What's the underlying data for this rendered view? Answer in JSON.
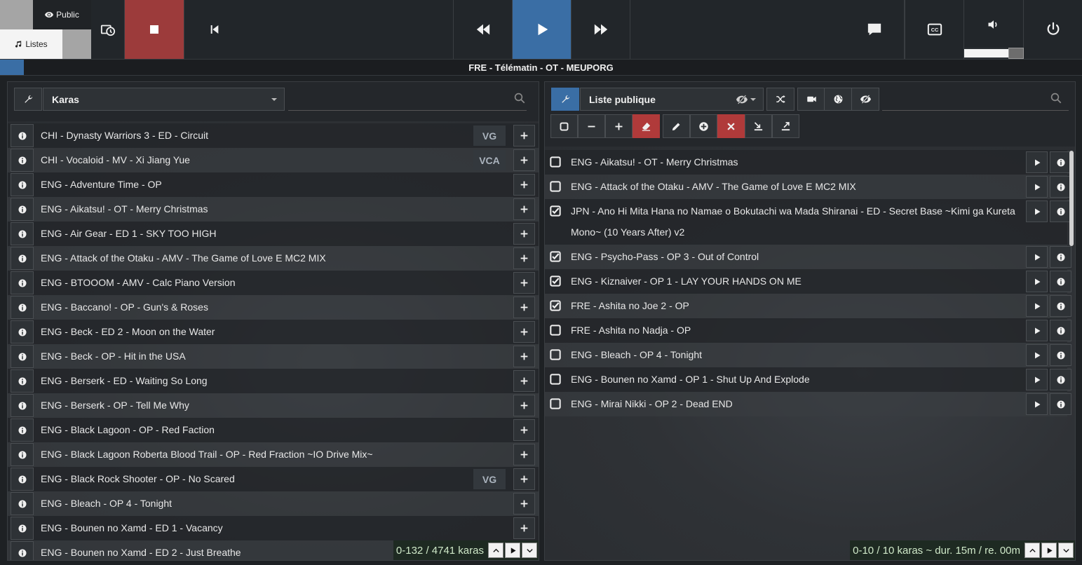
{
  "topbar": {
    "public_label": "Public",
    "listes_label": "Listes",
    "volume_level": 0.74
  },
  "player": {
    "now_playing": "FRE - Télématin - OT - MEUPORG",
    "progress": 0.022
  },
  "left": {
    "playlist_select": "Karas",
    "search_placeholder": "",
    "rows": [
      {
        "label": "CHI - Dynasty Warriors 3 - ED - Circuit",
        "tag": "VG"
      },
      {
        "label": "CHI - Vocaloid - MV - Xi Jiang Yue",
        "tag": "VCA"
      },
      {
        "label": "ENG - Adventure Time - OP",
        "tag": ""
      },
      {
        "label": "ENG - Aikatsu! - OT - Merry Christmas",
        "tag": ""
      },
      {
        "label": "ENG - Air Gear - ED 1 - SKY TOO HIGH",
        "tag": ""
      },
      {
        "label": "ENG - Attack of the Otaku - AMV - The Game of Love E MC2 MIX",
        "tag": ""
      },
      {
        "label": "ENG - BTOOOM - AMV - Calc Piano Version",
        "tag": ""
      },
      {
        "label": "ENG - Baccano! - OP - Gun's & Roses",
        "tag": ""
      },
      {
        "label": "ENG - Beck - ED 2 - Moon on the Water",
        "tag": ""
      },
      {
        "label": "ENG - Beck - OP - Hit in the USA",
        "tag": ""
      },
      {
        "label": "ENG - Berserk - ED - Waiting So Long",
        "tag": ""
      },
      {
        "label": "ENG - Berserk - OP - Tell Me Why",
        "tag": ""
      },
      {
        "label": "ENG - Black Lagoon - OP - Red Faction",
        "tag": ""
      },
      {
        "label": "ENG - Black Lagoon Roberta Blood Trail - OP - Red Fraction ~IO Drive Mix~",
        "tag": ""
      },
      {
        "label": "ENG - Black Rock Shooter - OP - No Scared",
        "tag": "VG"
      },
      {
        "label": "ENG - Bleach - OP 4 - Tonight",
        "tag": ""
      },
      {
        "label": "ENG - Bounen no Xamd - ED 1 - Vacancy",
        "tag": ""
      },
      {
        "label": "ENG - Bounen no Xamd - ED 2 - Just Breathe",
        "tag": ""
      }
    ],
    "footer": "0-132 / 4741 karas"
  },
  "right": {
    "playlist_select": "Liste publique",
    "search_placeholder": "",
    "rows": [
      {
        "label": "ENG - Aikatsu! - OT - Merry Christmas",
        "label2": "",
        "checked": false
      },
      {
        "label": "ENG - Attack of the Otaku - AMV - The Game of Love E MC2 MIX",
        "label2": "",
        "checked": false
      },
      {
        "label": "JPN - Ano Hi Mita Hana no Namae o Bokutachi wa Mada Shiranai - ED - Secret Base ~Kimi ga Kureta",
        "label2": "Mono~ (10 Years After) v2",
        "checked": true
      },
      {
        "label": "ENG - Psycho-Pass - OP 3 - Out of Control",
        "label2": "",
        "checked": true
      },
      {
        "label": "ENG - Kiznaiver - OP 1 - LAY YOUR HANDS ON ME",
        "label2": "",
        "checked": true
      },
      {
        "label": "FRE - Ashita no Joe 2 - OP",
        "label2": "",
        "checked": true
      },
      {
        "label": "FRE - Ashita no Nadja - OP",
        "label2": "",
        "checked": false
      },
      {
        "label": "ENG - Bleach - OP 4 - Tonight",
        "label2": "",
        "checked": false
      },
      {
        "label": "ENG - Bounen no Xamd - OP 1 - Shut Up And Explode",
        "label2": "",
        "checked": false
      },
      {
        "label": "ENG - Mirai Nikki - OP 2 - Dead END",
        "label2": "",
        "checked": false
      }
    ],
    "footer": "0-10 / 10 karas ~ dur. 15m / re. 00m"
  },
  "colors": {
    "accent_blue": "#3a6ea5",
    "stop_red": "#9c3b3b",
    "danger_red": "#b03a3a"
  }
}
